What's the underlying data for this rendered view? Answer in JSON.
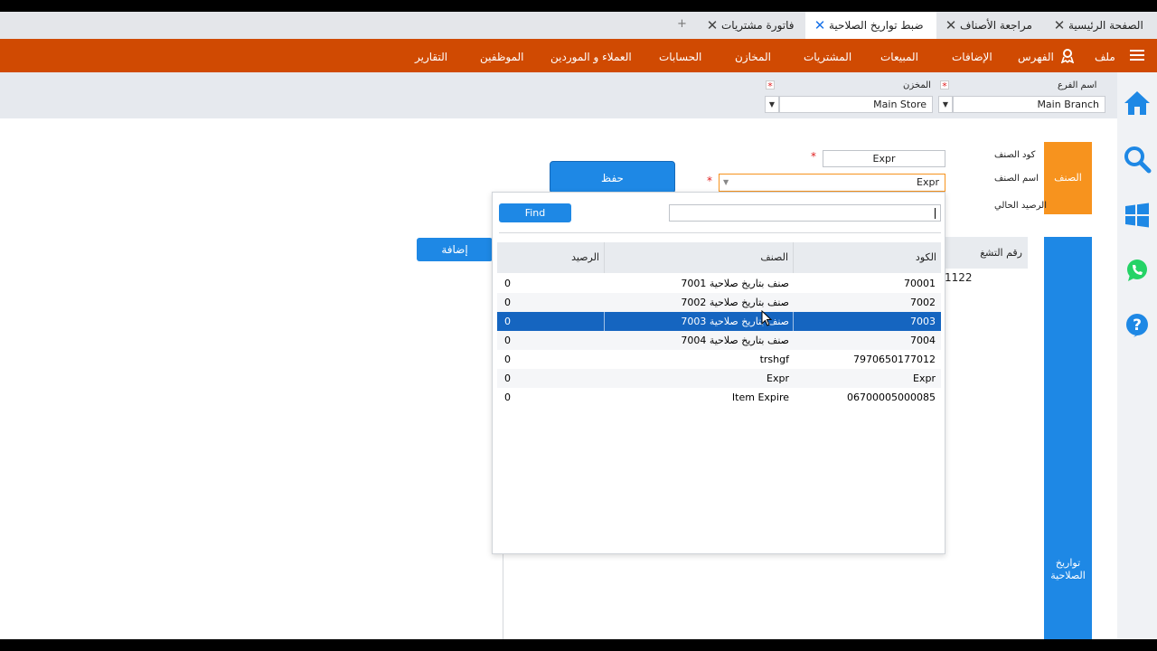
{
  "tabs": [
    {
      "label": "الصفحة الرئيسية"
    },
    {
      "label": "مراجعة الأصناف"
    },
    {
      "label": "ضبط تواريخ الصلاحية"
    },
    {
      "label": "فاتورة مشتريات"
    }
  ],
  "tab_add": "+",
  "menu": [
    "ملف",
    "الفهرس",
    "الإضافات",
    "المبيعات",
    "المشتريات",
    "المخازن",
    "الحسابات",
    "العملاء و الموردين",
    "الموظفين",
    "التقارير"
  ],
  "filters": {
    "branch_label": "اسم الفرع",
    "branch_value": "Main Branch",
    "store_label": "المخزن",
    "store_value": "Main Store",
    "required_mark": "*",
    "dropdown_glyph": "▼"
  },
  "form": {
    "section_item": "الصنف",
    "section_expiry": "تواريخ الصلاحية",
    "item_code_label": "كود الصنف",
    "item_code_value": "Expr",
    "item_name_label": "اسم الصنف",
    "item_name_value": "Expr",
    "balance_label": "الرصيد الحالي",
    "save_label": "حفظ",
    "add_label": "إضافة",
    "batch_header": "رقم التشغ",
    "batch_value": "1122",
    "asterisk": "*"
  },
  "popup": {
    "find_label": "Find",
    "search_value": "",
    "columns": {
      "code": "الكود",
      "name": "الصنف",
      "balance": "الرصيد"
    },
    "selected_index": 2,
    "rows": [
      {
        "code": "70001",
        "name": "صنف بتاريخ صلاحية 7001",
        "balance": "0"
      },
      {
        "code": "7002",
        "name": "صنف بتاريخ صلاحية 7002",
        "balance": "0"
      },
      {
        "code": "7003",
        "name": "صنف بتاريخ صلاحية 7003",
        "balance": "0"
      },
      {
        "code": "7004",
        "name": "صنف بتاريخ صلاحية 7004",
        "balance": "0"
      },
      {
        "code": "7970650177012",
        "name": "trshgf",
        "balance": "0"
      },
      {
        "code": "Expr",
        "name": "Expr",
        "balance": "0"
      },
      {
        "code": "06700005000085",
        "name": "Item Expire",
        "balance": "0"
      }
    ]
  },
  "colors": {
    "menu": "#d04a02",
    "accent_blue": "#1e88e5",
    "orange": "#f7931e",
    "selected_row": "#1565c0"
  },
  "sidebar_icons": [
    "home-icon",
    "search-icon",
    "windows-icon",
    "whatsapp-icon",
    "help-icon"
  ]
}
